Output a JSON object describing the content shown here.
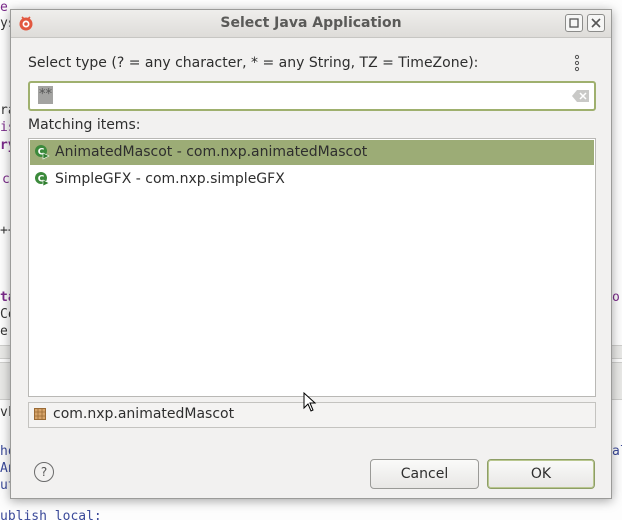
{
  "window": {
    "title": "Select Java Application",
    "maximize_icon": "maximize-icon",
    "close_icon": "close-icon"
  },
  "filter": {
    "label": "Select type (? = any character, * = any String, TZ = TimeZone):",
    "value": "**"
  },
  "matching": {
    "label": "Matching items:",
    "items": [
      {
        "label": "AnimatedMascot - com.nxp.animatedMascot",
        "selected": true,
        "icon": "java-class-run-icon"
      },
      {
        "label": "SimpleGFX - com.nxp.simpleGFX",
        "selected": false,
        "icon": "java-class-run-icon"
      }
    ]
  },
  "package": {
    "label": "com.nxp.animatedMascot",
    "icon": "package-icon"
  },
  "buttons": {
    "help": "?",
    "cancel": "Cancel",
    "ok": "OK"
  },
  "background": {
    "fragments": [
      "e",
      "ys",
      "ra",
      "is",
      "ry",
      "c",
      "++",
      "ta",
      "Co",
      "er",
      "vk",
      "ho",
      "An",
      "ut",
      "ublish local:",
      "o",
      "al"
    ]
  },
  "colors": {
    "selection": "#9cac76",
    "focus_border": "#9fb06e",
    "dialog_bg": "#f2f1f0"
  }
}
